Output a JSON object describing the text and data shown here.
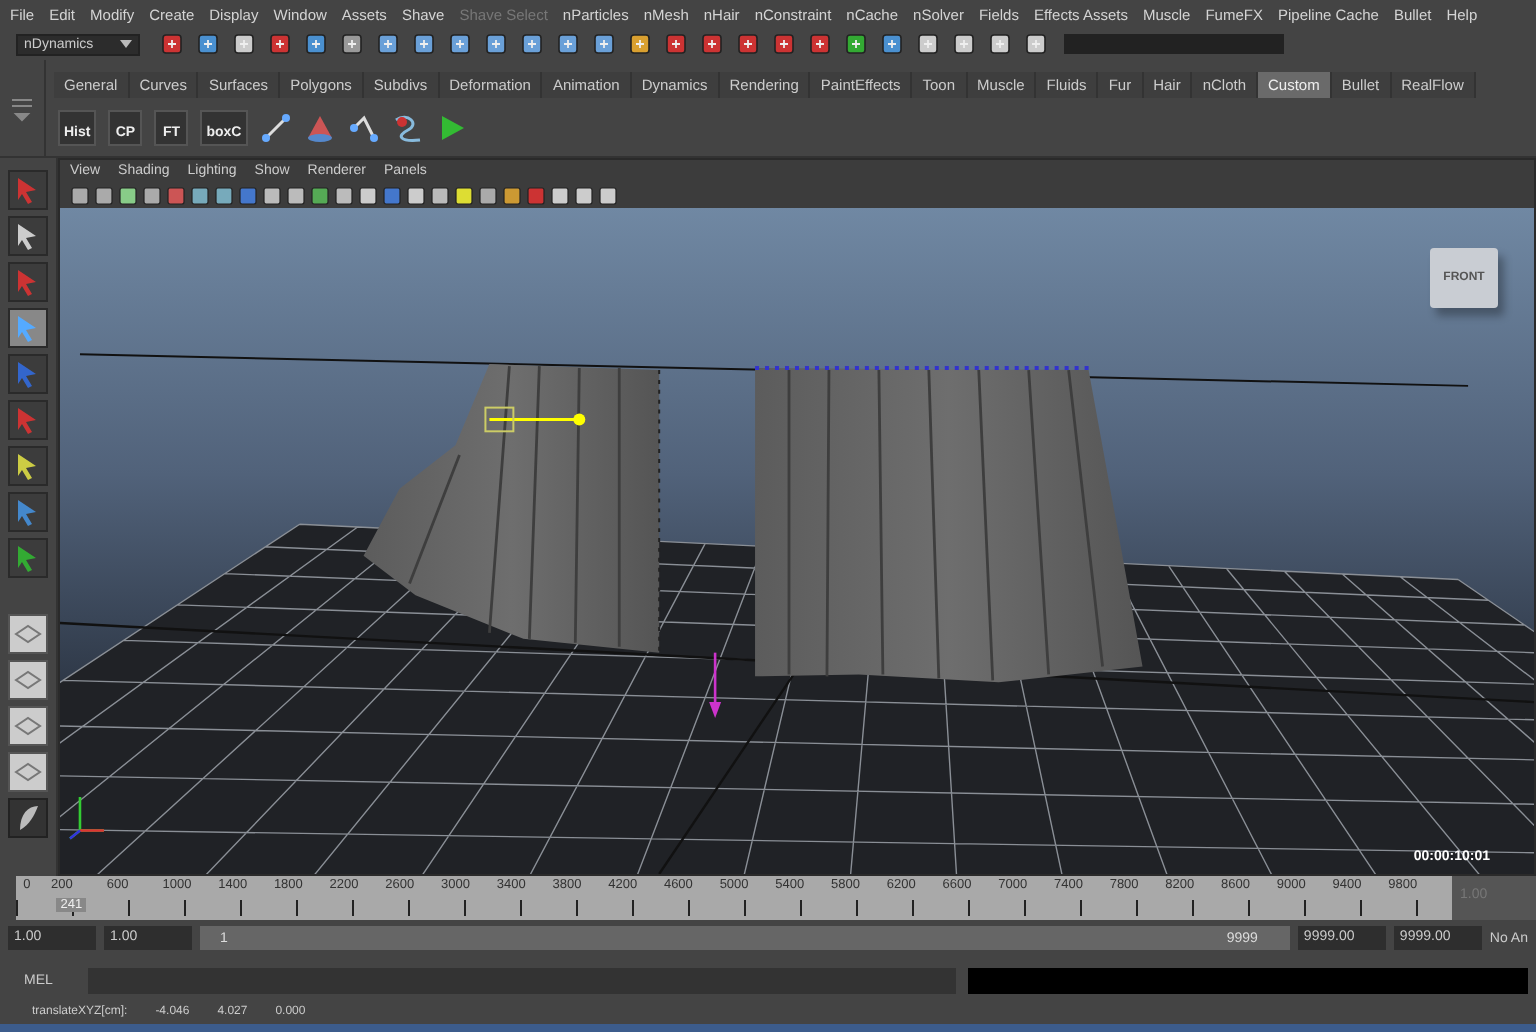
{
  "menu_bar": {
    "items": [
      {
        "label": "File",
        "disabled": false
      },
      {
        "label": "Edit",
        "disabled": false
      },
      {
        "label": "Modify",
        "disabled": false
      },
      {
        "label": "Create",
        "disabled": false
      },
      {
        "label": "Display",
        "disabled": false
      },
      {
        "label": "Window",
        "disabled": false
      },
      {
        "label": "Assets",
        "disabled": false
      },
      {
        "label": "Shave",
        "disabled": false
      },
      {
        "label": "Shave Select",
        "disabled": true
      },
      {
        "label": "nParticles",
        "disabled": false
      },
      {
        "label": "nMesh",
        "disabled": false
      },
      {
        "label": "nHair",
        "disabled": false
      },
      {
        "label": "nConstraint",
        "disabled": false
      },
      {
        "label": "nCache",
        "disabled": false
      },
      {
        "label": "nSolver",
        "disabled": false
      },
      {
        "label": "Fields",
        "disabled": false
      },
      {
        "label": "Effects Assets",
        "disabled": false
      },
      {
        "label": "Muscle",
        "disabled": false
      },
      {
        "label": "FumeFX",
        "disabled": false
      },
      {
        "label": "Pipeline Cache",
        "disabled": false
      },
      {
        "label": "Bullet",
        "disabled": false
      },
      {
        "label": "Help",
        "disabled": false
      }
    ]
  },
  "toolbar": {
    "mode": "nDynamics"
  },
  "shelf": {
    "tabs": [
      {
        "label": "General",
        "selected": false
      },
      {
        "label": "Curves",
        "selected": false
      },
      {
        "label": "Surfaces",
        "selected": false
      },
      {
        "label": "Polygons",
        "selected": false
      },
      {
        "label": "Subdivs",
        "selected": false
      },
      {
        "label": "Deformation",
        "selected": false
      },
      {
        "label": "Animation",
        "selected": false
      },
      {
        "label": "Dynamics",
        "selected": false
      },
      {
        "label": "Rendering",
        "selected": false
      },
      {
        "label": "PaintEffects",
        "selected": false
      },
      {
        "label": "Toon",
        "selected": false
      },
      {
        "label": "Muscle",
        "selected": false
      },
      {
        "label": "Fluids",
        "selected": false
      },
      {
        "label": "Fur",
        "selected": false
      },
      {
        "label": "Hair",
        "selected": false
      },
      {
        "label": "nCloth",
        "selected": false
      },
      {
        "label": "Custom",
        "selected": true
      },
      {
        "label": "Bullet",
        "selected": false
      },
      {
        "label": "RealFlow",
        "selected": false
      }
    ],
    "buttons": [
      {
        "label": "Hist"
      },
      {
        "label": "CP"
      },
      {
        "label": "FT"
      },
      {
        "label": "boxC"
      }
    ]
  },
  "viewport": {
    "menu": [
      "View",
      "Shading",
      "Lighting",
      "Show",
      "Renderer",
      "Panels"
    ],
    "view_cube": "FRONT",
    "timecode": "00:00:10:01"
  },
  "timeline": {
    "ticks": [
      "0",
      "200",
      "600",
      "1000",
      "1400",
      "1800",
      "2200",
      "2600",
      "3000",
      "3400",
      "3800",
      "4200",
      "4600",
      "5000",
      "5400",
      "5800",
      "6200",
      "6600",
      "7000",
      "7400",
      "7800",
      "8200",
      "8600",
      "9000",
      "9400",
      "9800"
    ],
    "current_frame": "241",
    "level": 0.024,
    "end_field": "1.00"
  },
  "range": {
    "start": "1.00",
    "range_start": "1.00",
    "slider_start": "1",
    "slider_end": "9999",
    "level": 1,
    "range_end": "9999.00",
    "end": "9999.00",
    "anim_layer": "No An"
  },
  "command_line": {
    "label": "MEL"
  },
  "help_line": {
    "label": "translateXYZ[cm]:",
    "values": [
      "-4.046",
      "4.027",
      "0.000"
    ]
  }
}
